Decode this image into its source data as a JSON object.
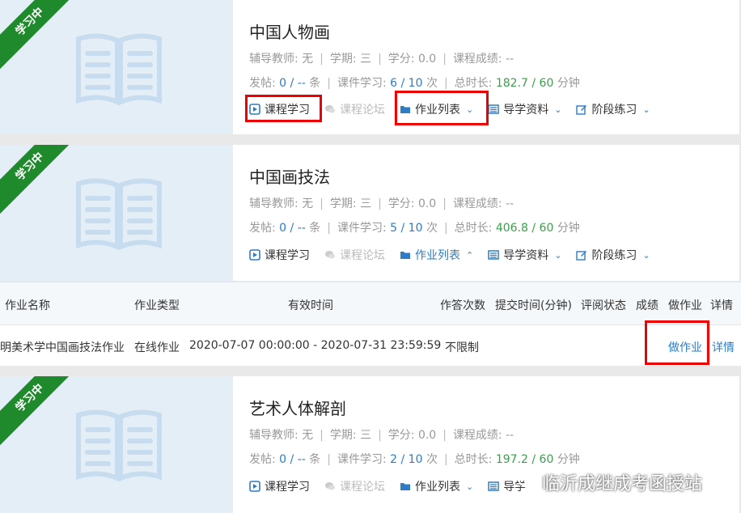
{
  "ribbon_label": "学习中",
  "courses": [
    {
      "title": "中国人物画",
      "teacher_label": "辅导教师:",
      "teacher": "无",
      "term_label": "学期:",
      "term": "三",
      "credit_label": "学分:",
      "credit": "0.0",
      "grade_label": "课程成绩:",
      "grade": "--",
      "posts_label": "发帖:",
      "posts": "0 / --",
      "posts_unit": "条",
      "study_label": "课件学习:",
      "study": "6 / 10",
      "study_unit": "次",
      "duration_label": "总时长:",
      "duration": "182.7 / 60",
      "duration_unit": "分钟",
      "actions": {
        "study": "课程学习",
        "forum": "课程论坛",
        "homework": "作业列表",
        "materials": "导学资料",
        "practice": "阶段练习"
      }
    },
    {
      "title": "中国画技法",
      "teacher_label": "辅导教师:",
      "teacher": "无",
      "term_label": "学期:",
      "term": "三",
      "credit_label": "学分:",
      "credit": "0.0",
      "grade_label": "课程成绩:",
      "grade": "--",
      "posts_label": "发帖:",
      "posts": "0 / --",
      "posts_unit": "条",
      "study_label": "课件学习:",
      "study": "5 / 10",
      "study_unit": "次",
      "duration_label": "总时长:",
      "duration": "406.8 / 60",
      "duration_unit": "分钟",
      "actions": {
        "study": "课程学习",
        "forum": "课程论坛",
        "homework": "作业列表",
        "materials": "导学资料",
        "practice": "阶段练习"
      }
    },
    {
      "title": "艺术人体解剖",
      "teacher_label": "辅导教师:",
      "teacher": "无",
      "term_label": "学期:",
      "term": "三",
      "credit_label": "学分:",
      "credit": "0.0",
      "grade_label": "课程成绩:",
      "grade": "--",
      "posts_label": "发帖:",
      "posts": "0 / --",
      "posts_unit": "条",
      "study_label": "课件学习:",
      "study": "2 / 10",
      "study_unit": "次",
      "duration_label": "总时长:",
      "duration": "197.2 / 60",
      "duration_unit": "分钟",
      "actions": {
        "study": "课程学习",
        "forum": "课程论坛",
        "homework": "作业列表",
        "materials": "导学"
      }
    }
  ],
  "homework_table": {
    "headers": [
      "作业名称",
      "作业类型",
      "有效时间",
      "作答次数",
      "提交时间(分钟)",
      "评阅状态",
      "成绩",
      "做作业",
      "详情"
    ],
    "row": {
      "name": "明美术学中国画技法作业",
      "type": "在线作业",
      "time": "2020-07-07 00:00:00 - 2020-07-31 23:59:59",
      "attempts": "不限制",
      "do": "做作业",
      "detail": "详情"
    }
  },
  "watermark": "临沂成继成考函授站",
  "colors": {
    "accent": "#2e7cc4",
    "green": "#3aa04a",
    "ribbon": "#1f8a2c",
    "highlight": "#e00000"
  }
}
